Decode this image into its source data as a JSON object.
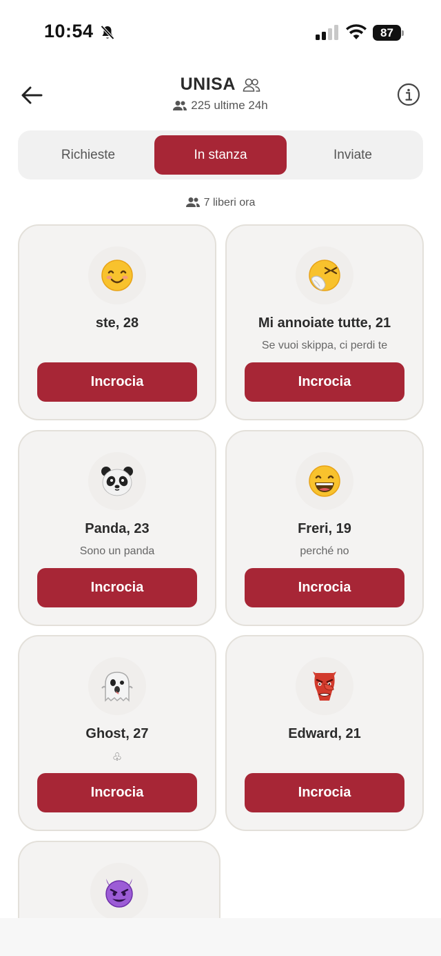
{
  "status_bar": {
    "time": "10:54",
    "battery": "87"
  },
  "header": {
    "title": "UNISA",
    "subtitle": "225 ultime 24h"
  },
  "tabs": {
    "requests": "Richieste",
    "in_room": "In stanza",
    "sent": "Inviate",
    "active": "In stanza"
  },
  "free_now": "7 liberi ora",
  "cards": [
    {
      "name": "ste, 28",
      "bio": "",
      "emoji": "😊",
      "button": "Incrocia"
    },
    {
      "name": "Mi annoiate tutte, 21",
      "bio": "Se vuoi skippa, ci perdi te",
      "emoji": "🤧",
      "button": "Incrocia"
    },
    {
      "name": "Panda, 23",
      "bio": "Sono un panda",
      "emoji": "🐼",
      "button": "Incrocia"
    },
    {
      "name": "Freri, 19",
      "bio": "perché no",
      "emoji": "😄",
      "button": "Incrocia"
    },
    {
      "name": "Ghost, 27",
      "bio": "♧",
      "emoji": "👻",
      "button": "Incrocia"
    },
    {
      "name": "Edward, 21",
      "bio": "",
      "emoji": "👺",
      "button": "Incrocia"
    },
    {
      "name": "",
      "bio": "",
      "emoji": "😈",
      "button": ""
    }
  ],
  "colors": {
    "accent": "#a72636",
    "card_bg": "#f4f3f2",
    "card_border": "#e3e0da"
  }
}
